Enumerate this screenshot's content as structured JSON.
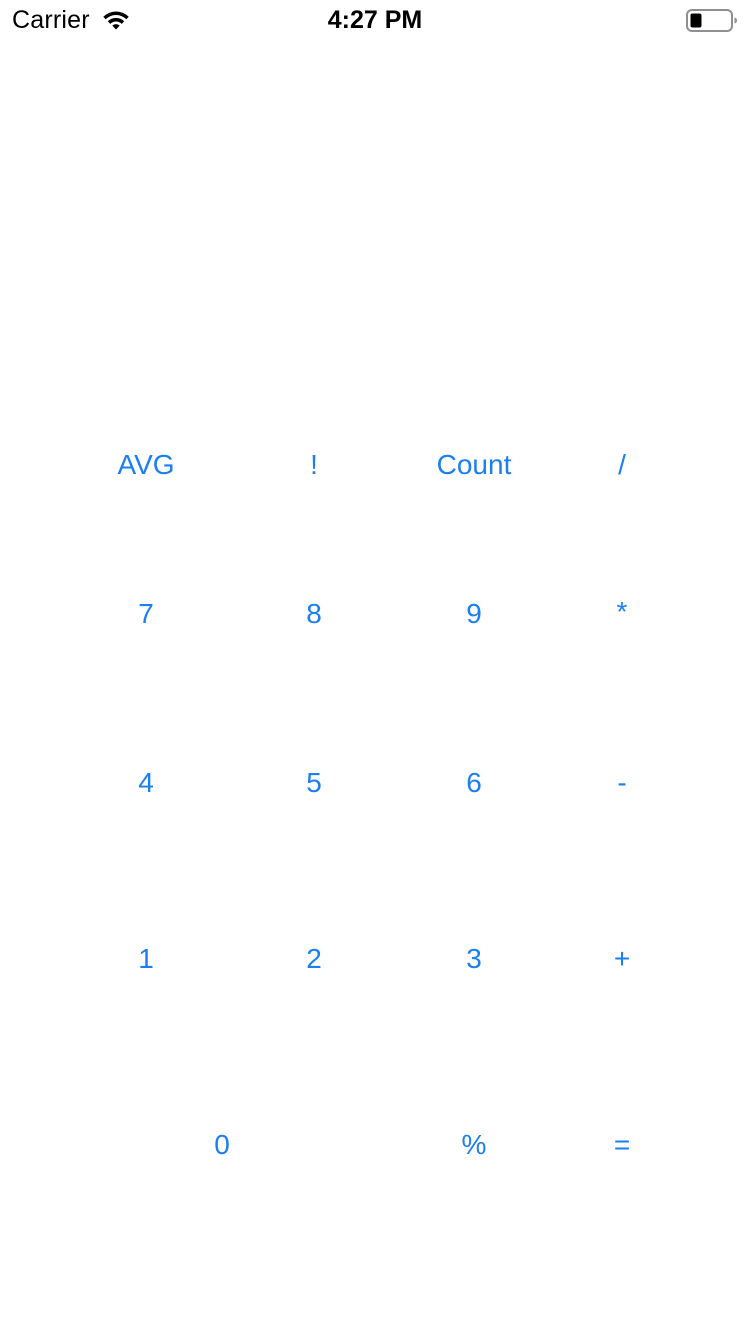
{
  "status_bar": {
    "carrier": "Carrier",
    "time": "4:27 PM"
  },
  "keypad": {
    "rows": [
      [
        "AVG",
        "!",
        "Count",
        "/"
      ],
      [
        "7",
        "8",
        "9",
        "*"
      ],
      [
        "4",
        "5",
        "6",
        "-"
      ],
      [
        "1",
        "2",
        "3",
        "+"
      ],
      [
        "0",
        "%",
        "="
      ]
    ]
  },
  "colors": {
    "accent": "#1a7ff0",
    "background": "#ffffff",
    "status_text": "#000000"
  },
  "icons": {
    "signal": "wifi-icon",
    "battery": "battery-icon"
  }
}
